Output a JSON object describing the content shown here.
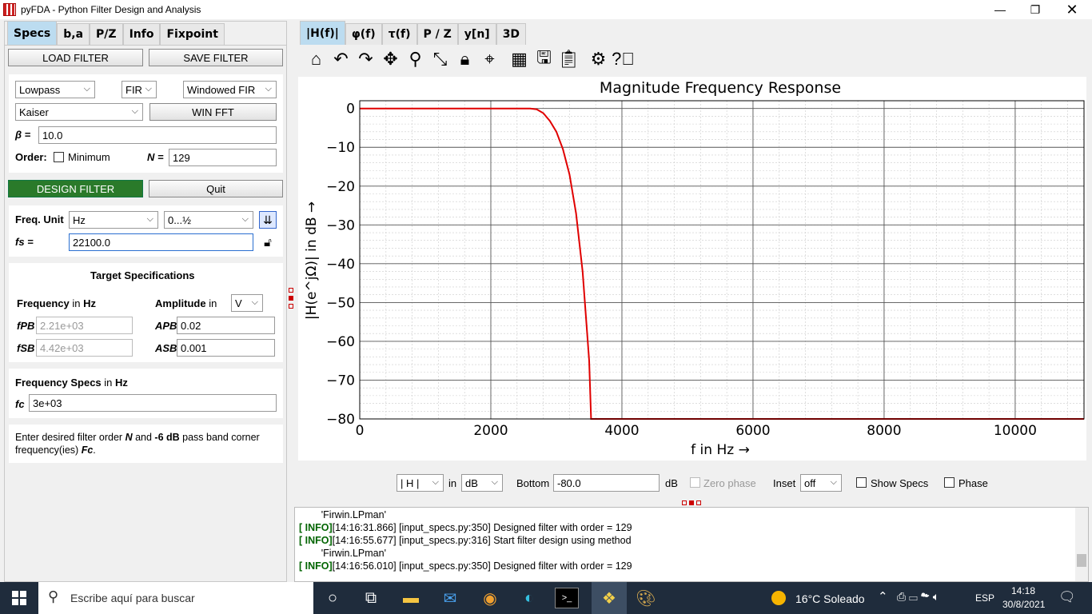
{
  "window": {
    "title": "pyFDA - Python Filter Design and Analysis"
  },
  "left_tabs": [
    "Specs",
    "b,a",
    "P/Z",
    "Info",
    "Fixpoint"
  ],
  "buttons": {
    "load": "LOAD FILTER",
    "save": "SAVE FILTER",
    "win_fft": "WIN FFT",
    "design": "DESIGN FILTER",
    "quit": "Quit"
  },
  "filter": {
    "response_type": "Lowpass",
    "type": "FIR",
    "method": "Windowed FIR",
    "window": "Kaiser",
    "beta_label": "β =",
    "beta": "10.0",
    "order_label": "Order:",
    "minimum_label": "Minimum",
    "n_label": "N =",
    "n": "129"
  },
  "freq_unit": {
    "label": "Freq. Unit",
    "unit": "Hz",
    "range": "0...½",
    "fs_label": "fs =",
    "fs": "22100.0"
  },
  "target": {
    "title": "Target Specifications",
    "freq_label": "Frequency",
    "freq_in": "in",
    "freq_unit": "Hz",
    "amp_label": "Amplitude",
    "amp_in": "in",
    "amp_unit": "V",
    "fpb_label": "fPB",
    "fpb": "2.21e+03",
    "fsb_label": "fSB",
    "fsb": "4.42e+03",
    "apb_label": "APB",
    "apb": "0.02",
    "asb_label": "ASB",
    "asb": "0.001"
  },
  "freq_specs": {
    "title": "Frequency Specs",
    "in": "in",
    "unit": "Hz",
    "fc_label": "fc",
    "fc": "3e+03"
  },
  "help_text": {
    "line1_a": "Enter desired filter order ",
    "line1_n": "N",
    "line1_b": " and ",
    "line1_c": "-6 dB",
    "line1_d": " pass band corner",
    "line2_a": "frequency(ies) ",
    "line2_fc": "Fc",
    "line2_b": "."
  },
  "right_tabs": [
    "|H(f)|",
    "φ(f)",
    "τ(f)",
    "P / Z",
    "y[n]",
    "3D"
  ],
  "toolbar_icons": [
    "home-icon",
    "undo-icon",
    "redo-icon",
    "pan-icon",
    "zoom-icon",
    "fullscreen-icon",
    "lock-icon",
    "marker-icon",
    "grid-icon",
    "save-icon",
    "clipboard-icon",
    "settings-icon",
    "help-icon"
  ],
  "plot_controls": {
    "mode": "| H |",
    "in": "in",
    "unit": "dB",
    "bottom_label": "Bottom",
    "bottom": "-80.0",
    "bottom_unit": "dB",
    "zero_phase": "Zero phase",
    "inset_label": "Inset",
    "inset": "off",
    "show_specs": "Show Specs",
    "phase": "Phase"
  },
  "chart_data": {
    "type": "line",
    "title": "Magnitude Frequency Response",
    "xlabel": "f in Hz →",
    "ylabel": "|H(e^jΩ)| in dB →",
    "xlim": [
      0,
      11050
    ],
    "ylim": [
      -80,
      2
    ],
    "xticks": [
      "0",
      "2000",
      "4000",
      "6000",
      "8000",
      "10000"
    ],
    "yticks": [
      "0",
      "−10",
      "−20",
      "−30",
      "−40",
      "−50",
      "−60",
      "−70",
      "−80"
    ],
    "grid": true,
    "series": [
      {
        "color": "#e00000",
        "x": [
          0,
          2600,
          2700,
          2800,
          2900,
          3000,
          3100,
          3200,
          3300,
          3400,
          3500,
          3530,
          11050
        ],
        "y": [
          0,
          0,
          -0.2,
          -1.2,
          -3.2,
          -6,
          -10.5,
          -17,
          -27,
          -42,
          -65,
          -80,
          -80
        ]
      }
    ]
  },
  "console": {
    "lines": [
      {
        "tag": "",
        "text": "        'Firwin.LPman'"
      },
      {
        "tag": "[ INFO]",
        "text": "[14:16:31.866] [input_specs.py:350] Designed filter with order = 129"
      },
      {
        "tag": "[ INFO]",
        "text": "[14:16:55.677] [input_specs.py:316] Start filter design using method"
      },
      {
        "tag": "",
        "text": "        'Firwin.LPman'"
      },
      {
        "tag": "[ INFO]",
        "text": "[14:16:56.010] [input_specs.py:350] Designed filter with order = 129"
      }
    ]
  },
  "taskbar": {
    "search": "Escribe aquí para buscar",
    "weather": "16°C  Soleado",
    "lang": "ESP",
    "time": "14:18",
    "date": "30/8/2021"
  }
}
